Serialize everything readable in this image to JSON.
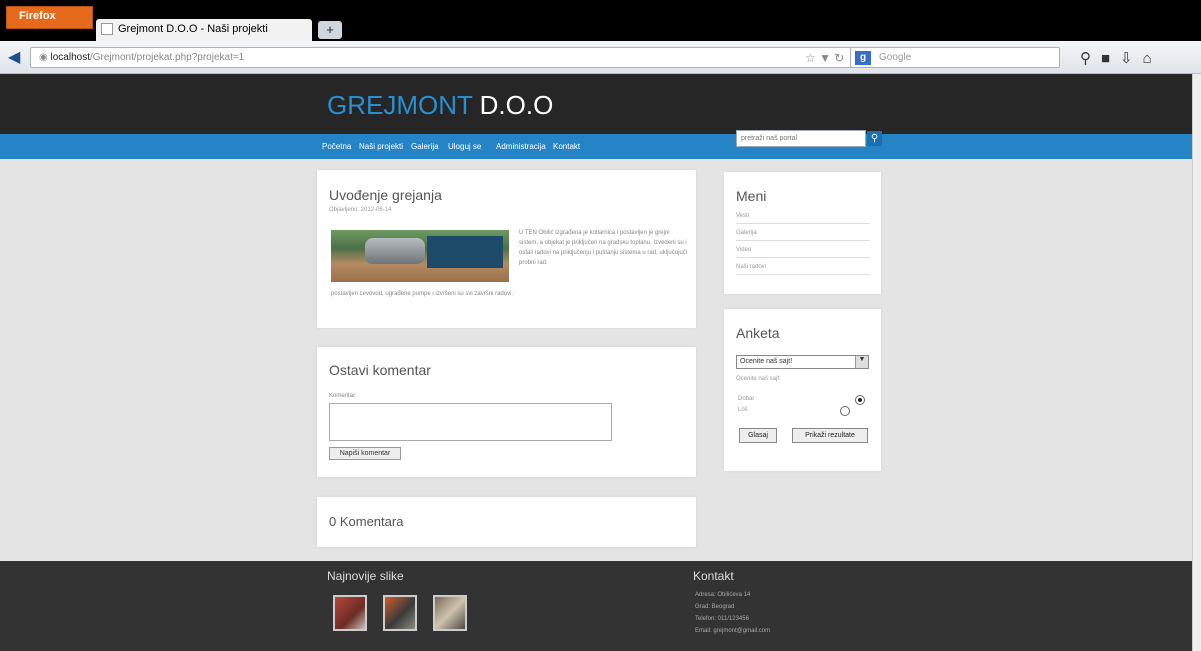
{
  "browser": {
    "app_button": "Firefox",
    "tab_title": "Grejmont D.O.O - Naši projekti",
    "new_tab": "+",
    "url_host": "localhost",
    "url_path": "/Grejmont/projekat.php?projekat=1",
    "search_engine": "Google"
  },
  "site": {
    "logo_part1": "GREJMONT",
    "logo_part2": " D.O.O",
    "menu": [
      "Početna",
      "Naši projekti",
      "Galerija",
      "Uloguj se",
      "Administracija",
      "Kontakt"
    ],
    "search_placeholder": "pretraži naš portal"
  },
  "project": {
    "title": "Uvođenje grejanja",
    "date": "Objavljeno: 2012-06-14",
    "text": "U TEN Obilić izgrađena je kotlarnica i postavljen je grejni sistem, a objekat je priključen na gradsku toplanu. Izvedeni su i ostali radovi na priključenju i puštanju sistema u rad, uključujući probni rad.",
    "text2": "postavljen cevovod, ugrađene pumpe i izvršeni su svi završni radovi."
  },
  "comment_form": {
    "title": "Ostavi komentar",
    "label": "Komentar:",
    "submit": "Napiši komentar"
  },
  "comments": {
    "count_label": "0 Komentara"
  },
  "sidebar_menu": {
    "title": "Meni",
    "items": [
      "Vesti",
      "Galerija",
      "Video",
      "Naši radovi"
    ]
  },
  "poll": {
    "title": "Anketa",
    "selected": "Ocenite naš sajt!",
    "question": "Ocenite naš sajt:",
    "options": [
      "Dobar",
      "Loš"
    ],
    "vote_button": "Glasaj",
    "results_button": "Prikaži rezultate"
  },
  "footer": {
    "gallery_title": "Najnovije slike",
    "contact_title": "Kontakt",
    "contact_lines": [
      "Adresa: Obilićeva 14",
      "Grad: Beograd",
      "Telefon: 011/123456",
      "Email: grejmont@gmail.com"
    ]
  }
}
